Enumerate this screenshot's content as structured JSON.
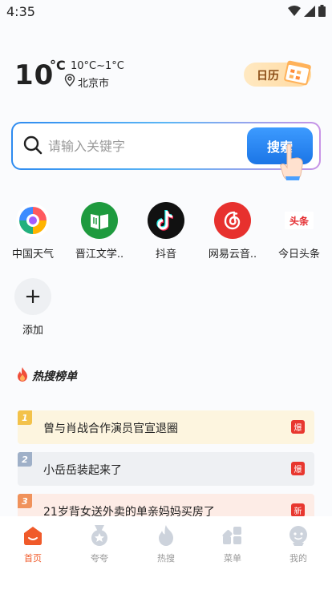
{
  "status_bar": {
    "time": "4:35"
  },
  "weather": {
    "temperature": "10",
    "unit": "°C",
    "range": "10°C~1°C",
    "city": "北京市"
  },
  "calendar": {
    "label": "日历"
  },
  "search": {
    "placeholder": "请输入关键字",
    "button_label": "搜索"
  },
  "apps": [
    {
      "label": "中国天气",
      "icon": "china-weather-icon"
    },
    {
      "label": "晋江文学..",
      "icon": "jinjiang-icon"
    },
    {
      "label": "抖音",
      "icon": "douyin-icon"
    },
    {
      "label": "网易云音..",
      "icon": "netease-music-icon"
    },
    {
      "label": "今日头条",
      "icon": "toutiao-icon"
    }
  ],
  "add_app": {
    "label": "添加"
  },
  "hot_list": {
    "title": "热搜榜单",
    "items": [
      {
        "rank": "1",
        "title": "曾与肖战合作演员官宣退圈",
        "badge": "爆",
        "bg": "#fdf5df",
        "rank_color": "#f3c24a"
      },
      {
        "rank": "2",
        "title": "小岳岳装起来了",
        "badge": "爆",
        "bg": "#eef0f3",
        "rank_color": "#9fb0c8"
      },
      {
        "rank": "3",
        "title": "21岁背女送外卖的单亲妈妈买房了",
        "badge": "新",
        "bg": "#fdece6",
        "rank_color": "#f0925b"
      }
    ]
  },
  "tabbar": {
    "items": [
      {
        "label": "首页",
        "icon": "home-icon",
        "active": true
      },
      {
        "label": "夸夸",
        "icon": "medal-icon",
        "active": false
      },
      {
        "label": "热搜",
        "icon": "flame-icon",
        "active": false
      },
      {
        "label": "菜单",
        "icon": "grid-icon",
        "active": false
      },
      {
        "label": "我的",
        "icon": "profile-icon",
        "active": false
      }
    ]
  },
  "colors": {
    "accent": "#f05a2a",
    "search_blue": "#1b75e6"
  }
}
